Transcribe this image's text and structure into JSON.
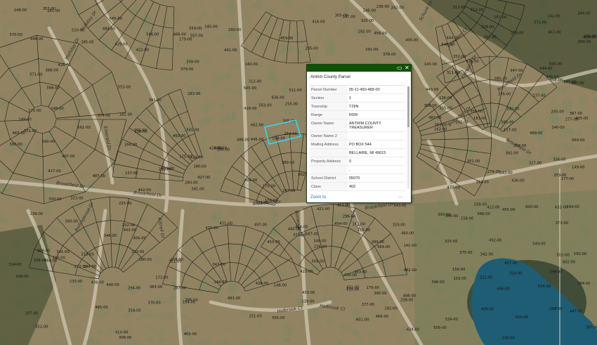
{
  "popup": {
    "title": "Antrim County Parcel",
    "icons": [
      "maximize-icon",
      "close-icon"
    ],
    "fields": [
      {
        "label": "Parcel Number",
        "value": "05-11-450-488-00"
      },
      {
        "label": "Section",
        "value": "1"
      },
      {
        "label": "Township",
        "value": "T29N"
      },
      {
        "label": "Range",
        "value": "R5W"
      },
      {
        "label": "Owner Name",
        "value": "ANTRIM COUNTY TREASURER"
      },
      {
        "label": "Owner Name 2",
        "value": ""
      },
      {
        "label": "Mailing Address",
        "value": "PO BOX 544"
      },
      {
        "label": "",
        "value": "BELLAIRE, MI 49615"
      },
      {
        "label": "Property Address",
        "value": "0"
      },
      {
        "label": "",
        "value": ","
      },
      {
        "label": "School District",
        "value": "05070"
      },
      {
        "label": "Class",
        "value": "402"
      }
    ],
    "zoom_label": "Zoom to",
    "more_label": "…"
  },
  "streets": [
    "Holliday Dr",
    "Holliday Dr",
    "Emerald Dr",
    "Brookfield Dr",
    "Brookfield Dr",
    "Brookfield Dr",
    "Brookfield Dr",
    "Brookfield Dr",
    "Brookfield Dr",
    "Brookfield Dr",
    "Rollingwood Dr",
    "Kittrell Dr",
    "Bonwood Dr",
    "Holbrook Ct",
    "Holbrook Ct",
    "Fairwood Ct",
    "Fairwood Dr",
    "Schunk Dr",
    "Scenic Dr"
  ],
  "parcels": [
    "182-00",
    "179-00",
    "180-00",
    "181-00",
    "183-00",
    "176-00",
    "177-00",
    "175-00",
    "174-00",
    "173-00",
    "172-00",
    "171-00",
    "170-00",
    "163-00",
    "162-00",
    "161-00",
    "160-00",
    "159-00",
    "158-00",
    "157-00",
    "156-00",
    "155-00",
    "154-00",
    "153-00",
    "136-00",
    "137-00",
    "138-00",
    "139-00",
    "140-00",
    "141-00",
    "142-00",
    "143-00",
    "144-00",
    "145-00",
    "146-00",
    "147-00",
    "148-00",
    "149-00",
    "460-00",
    "459-00",
    "458-00",
    "457-00",
    "456-00",
    "455-00",
    "454-00",
    "453-00",
    "452-00",
    "451-00",
    "450-00",
    "449-00",
    "448-00",
    "447-00",
    "446-00",
    "462-00",
    "463-00",
    "464-00",
    "465-00",
    "466-00",
    "467-00",
    "487-00",
    "486-00",
    "485-00",
    "484-00",
    "483-00",
    "482-00",
    "488-00",
    "489-00",
    "490-00",
    "491-00",
    "492-00",
    "313-00",
    "312-00",
    "310-00",
    "511-00",
    "510-00",
    "509-00",
    "505-00",
    "540-00",
    "543-00",
    "544-00",
    "545-00",
    "546-00",
    "547-00",
    "548-00",
    "549-00",
    "550-00",
    "551-00",
    "552-00",
    "553-00",
    "554-00",
    "555-00",
    "556-00",
    "557-00",
    "558-00",
    "559-00",
    "560-00",
    "561-00",
    "562-00",
    "563-00",
    "564-00",
    "565-00",
    "566-00",
    "567-00",
    "568-00",
    "569-00",
    "570-00",
    "571-00",
    "598-00",
    "599-00",
    "600-00",
    "601-00",
    "602-00",
    "303-00",
    "304-00",
    "305-00",
    "306-00",
    "307-00",
    "308-00",
    "309-00",
    "310-00",
    "311-00",
    "312-00",
    "313-00",
    "314-00",
    "243-00",
    "244-00",
    "245-00",
    "246-00",
    "247-00",
    "248-00",
    "249-00",
    "250-00",
    "251-00",
    "252-00",
    "253-00",
    "254-00",
    "255-00",
    "233-00",
    "234-00",
    "235-00",
    "236-00",
    "237-00",
    "238-00",
    "239-00",
    "240-00",
    "241-00",
    "242-00",
    "277-00",
    "278-00",
    "279-00",
    "280-00",
    "281-00",
    "282-00",
    "283-00",
    "284-00",
    "285-00",
    "286-00",
    "287-00",
    "288-00",
    "289-00",
    "290-00",
    "291-00",
    "292-00",
    "296-00",
    "295-00",
    "294-00",
    "293-00",
    "319-00",
    "320-00",
    "321-00",
    "322-00",
    "323-00",
    "324-00",
    "325-00",
    "326-00",
    "327-00",
    "328-00",
    "329-00",
    "330-00",
    "336-00",
    "337-00",
    "338-00",
    "339-00",
    "340-00",
    "341-00",
    "342-00",
    "343-00",
    "344-00",
    "345-00",
    "346-00",
    "347-00",
    "348-00",
    "349-00",
    "350-00",
    "351-00",
    "352-00",
    "353-00",
    "354-00",
    "355-00",
    "356-00",
    "357-00",
    "404-00",
    "405-00",
    "406-00",
    "407-00",
    "408-00",
    "409-00",
    "410-00",
    "411-00",
    "412-00",
    "413-00",
    "414-00",
    "415-00",
    "416-00",
    "417-00",
    "418-00",
    "419-00",
    "420-00",
    "421-00",
    "422-00",
    "423-00",
    "424-00",
    "425-00",
    "426-00",
    "427-00",
    "428-00",
    "429-00",
    "430-00",
    "431-00",
    "432-00",
    "433-00",
    "434-00",
    "435-00",
    "436-00",
    "437-00",
    "438-00",
    "439-00",
    "440-00",
    "441-00",
    "442-00",
    "443-00",
    "444-00",
    "445-00",
    "370-00",
    "371-00",
    "372-00",
    "373-00",
    "374-00",
    "375-00",
    "376-00",
    "377-00",
    "378-00",
    "379-00",
    "380-00",
    "381-00",
    "382-00",
    "383-00",
    "384-00",
    "385-00",
    "386-00",
    "387-00",
    "388-00",
    "389-00",
    "390-00",
    "391-00",
    "392-00",
    "393-00",
    "394-00",
    "395-00",
    "396-00",
    "397-00",
    "398-00",
    "399-00",
    "497-00",
    "498-00",
    "499-00",
    "500-00",
    "501-00",
    "502-00",
    "636-00"
  ],
  "colors": {
    "header": "#0e5208",
    "selection": "#35d7f0",
    "parcel_line": "#141414",
    "link": "#1e7aa6",
    "lake": "#1e5d74"
  }
}
